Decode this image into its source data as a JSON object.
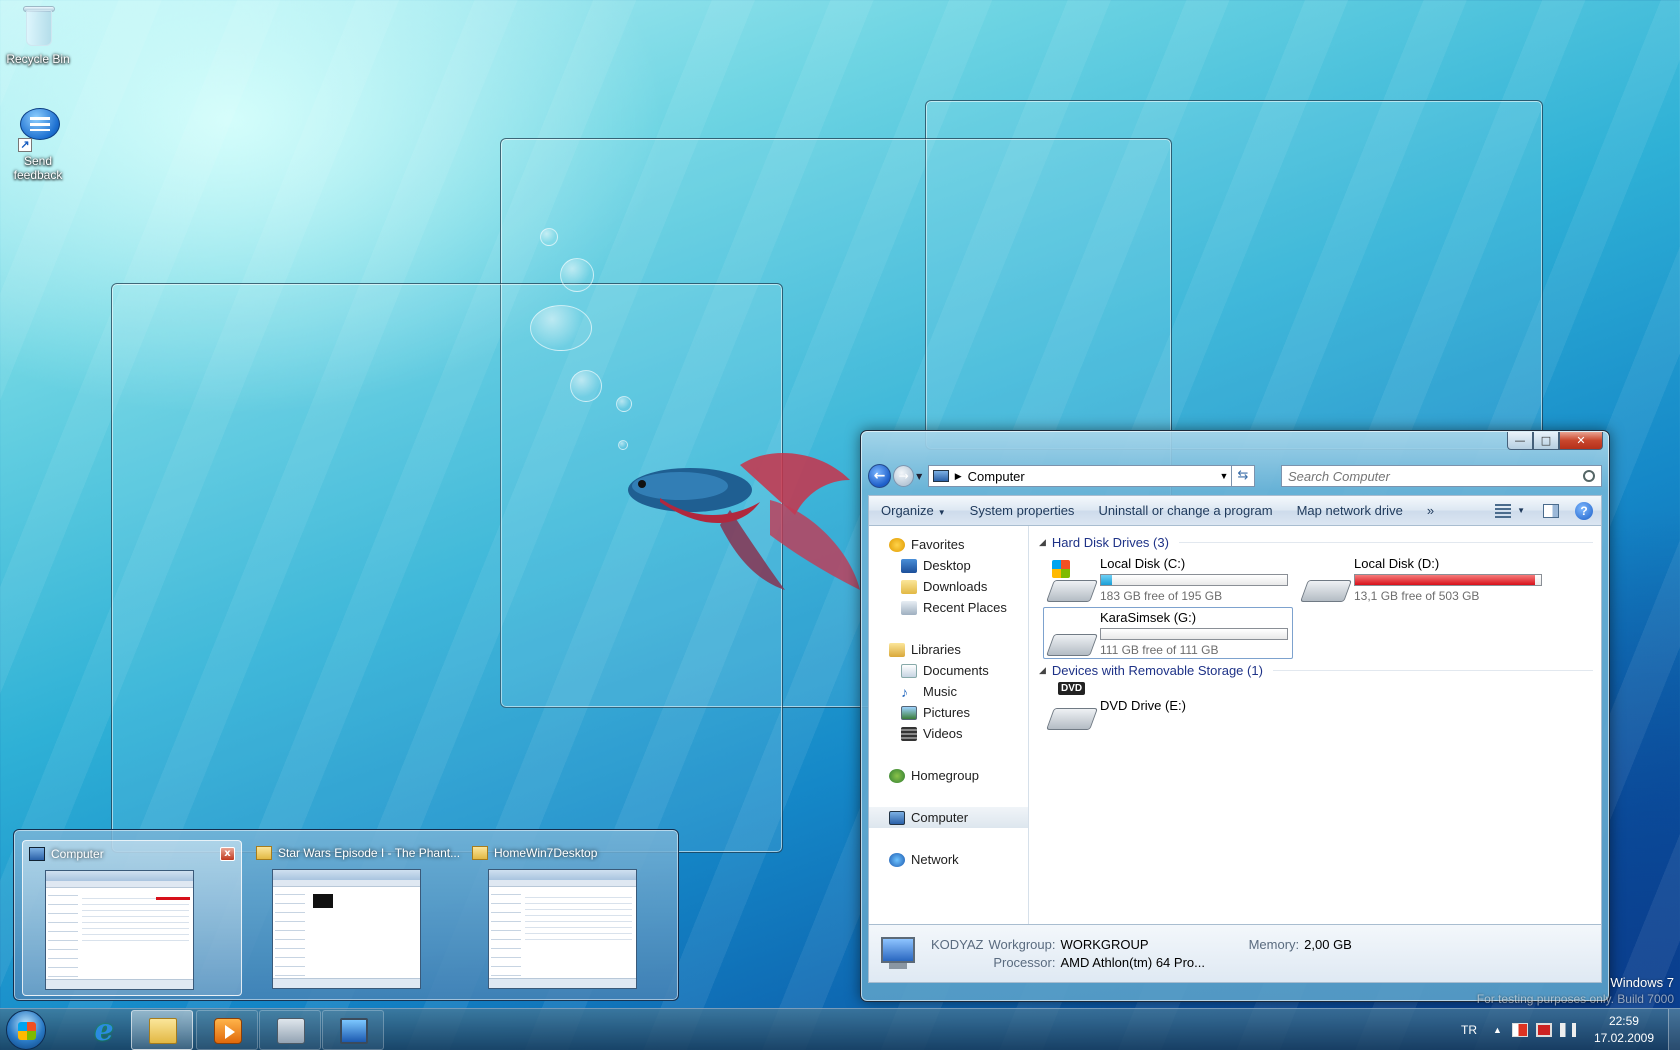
{
  "desktop": {
    "icons": [
      {
        "label": "Recycle Bin",
        "icon": "recycle-bin-icon"
      },
      {
        "label": "Send feedback",
        "icon": "feedback-icon"
      }
    ],
    "watermark": {
      "line1": "Windows 7",
      "line2": "For testing purposes only. Build 7000"
    }
  },
  "explorer": {
    "address_path": "Computer",
    "search_placeholder": "Search Computer",
    "toolbar": {
      "organize": "Organize",
      "system_properties": "System properties",
      "uninstall": "Uninstall or change a program",
      "map_drive": "Map network drive",
      "more": "»"
    },
    "nav": {
      "favorites": "Favorites",
      "desktop": "Desktop",
      "downloads": "Downloads",
      "recent": "Recent Places",
      "libraries": "Libraries",
      "documents": "Documents",
      "music": "Music",
      "pictures": "Pictures",
      "videos": "Videos",
      "homegroup": "Homegroup",
      "computer": "Computer",
      "network": "Network"
    },
    "groups": {
      "hard_disks": "Hard Disk Drives (3)",
      "removable": "Devices with Removable Storage (1)"
    },
    "drives": [
      {
        "name": "Local Disk (C:)",
        "free": "183 GB free of 195 GB",
        "used_fraction": 0.06,
        "color": "#1a9fd6"
      },
      {
        "name": "Local Disk (D:)",
        "free": "13,1 GB free of 503 GB",
        "used_fraction": 0.97,
        "color": "#d7101a"
      },
      {
        "name": "KaraSimsek (G:)",
        "free": "111 GB free of 111 GB",
        "used_fraction": 0.0,
        "color": "#1a9fd6"
      }
    ],
    "dvd": {
      "name": "DVD Drive (E:)",
      "badge": "DVD"
    },
    "details": {
      "computer_name": "KODYAZ",
      "workgroup_label": "Workgroup:",
      "workgroup": "WORKGROUP",
      "memory_label": "Memory:",
      "memory": "2,00 GB",
      "processor_label": "Processor:",
      "processor": "AMD Athlon(tm) 64 Pro..."
    }
  },
  "thumbnails": [
    {
      "title": "Computer",
      "close": "x"
    },
    {
      "title": "Star Wars Episode I - The Phant..."
    },
    {
      "title": "HomeWin7Desktop"
    }
  ],
  "taskbar": {
    "tray": {
      "lang": "TR",
      "time": "22:59",
      "date": "17.02.2009"
    }
  }
}
